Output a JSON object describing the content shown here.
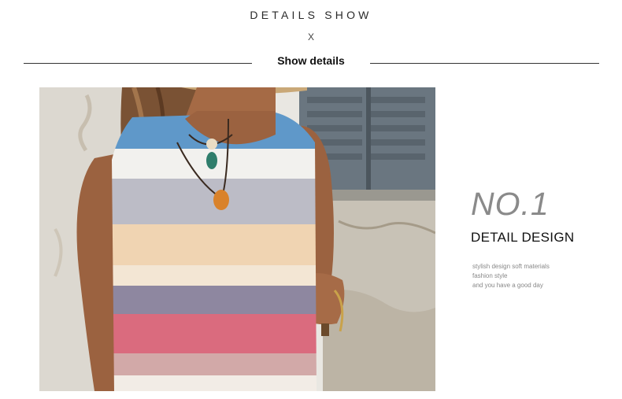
{
  "header": {
    "title": "DETAILS SHOW",
    "mark": "X",
    "subtitle": "Show details"
  },
  "feature": {
    "number": "NO.1",
    "heading": "DETAIL DESIGN",
    "lines": [
      "stylish design soft materials",
      "fashion style",
      "and you have a good day"
    ]
  },
  "photo": {
    "subject": "woman wearing sleeveless striped tank top",
    "stripe_colors": [
      "#5f98c9",
      "#f2f1ee",
      "#bcbcc6",
      "#f0d4b2",
      "#f3e6d4",
      "#8e87a0",
      "#da6b7e",
      "#d2a9a8",
      "#f2ece6"
    ]
  }
}
